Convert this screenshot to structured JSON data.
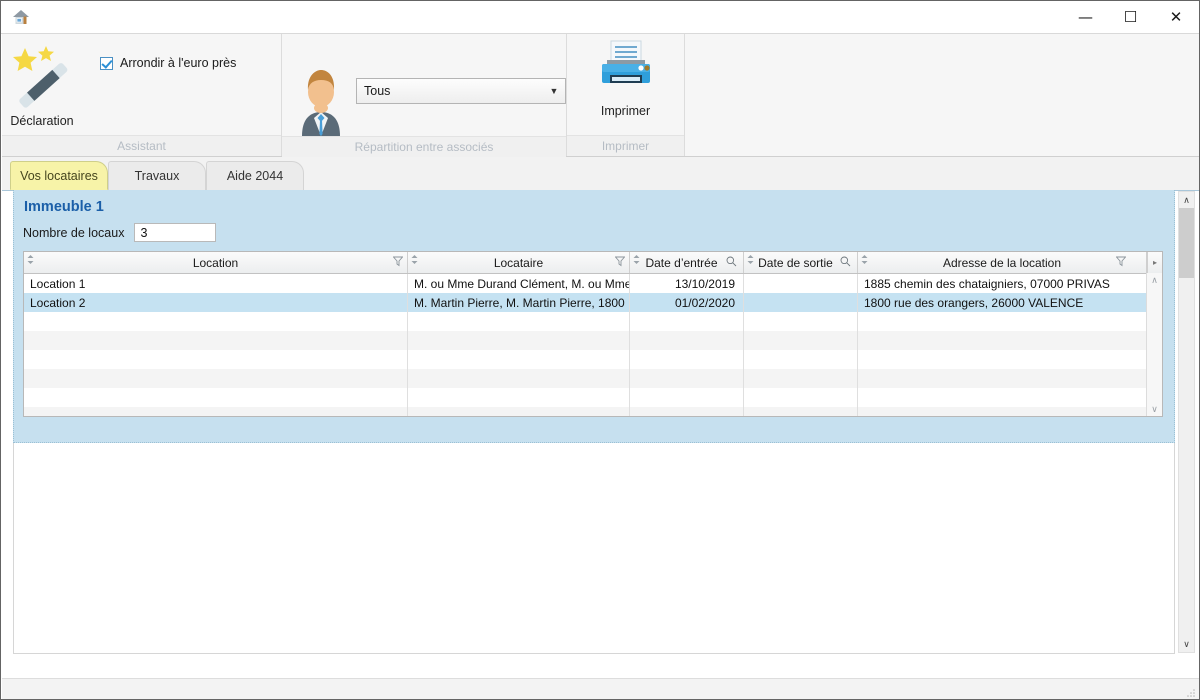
{
  "window": {
    "home_icon": "home-icon",
    "minimize": "—",
    "maximize": "☐",
    "close": "✕"
  },
  "ribbon": {
    "groups": [
      {
        "title": "Assistant"
      },
      {
        "title": "Répartition entre associés"
      },
      {
        "title": "Imprimer"
      }
    ],
    "declaration_button": {
      "label": "Déclaration",
      "icon": "magic-wand-icon"
    },
    "round_euro_checkbox": {
      "label": "Arrondir à l'euro près",
      "checked": true
    },
    "partners_icon": "user-avatar-icon",
    "partners_combo": {
      "value": "Tous",
      "arrow": "▼",
      "options": [
        "Tous"
      ]
    },
    "print_button": {
      "label": "Imprimer",
      "icon": "printer-icon"
    }
  },
  "tabs": [
    {
      "label": "Vos locataires",
      "active": true
    },
    {
      "label": "Travaux",
      "active": false
    },
    {
      "label": "Aide 2044",
      "active": false
    }
  ],
  "panel": {
    "building_title": "Immeuble 1",
    "locals_count_label": "Nombre de locaux",
    "locals_count_value": "3"
  },
  "grid": {
    "columns": [
      {
        "label": "Location",
        "icon": "filter-icon",
        "align": "left"
      },
      {
        "label": "Locataire",
        "icon": "filter-icon",
        "align": "left"
      },
      {
        "label": "Date d’entrée",
        "icon": "search-icon",
        "align": "right"
      },
      {
        "label": "Date de sortie",
        "icon": "search-icon",
        "align": "right"
      },
      {
        "label": "Adresse de la location",
        "icon": "filter-icon",
        "align": "left"
      }
    ],
    "rows": [
      {
        "location": "Location 1",
        "locataire": "M. ou Mme Durand Clément, M. ou Mme",
        "date_entree": "13/10/2019",
        "date_sortie": "",
        "adresse": "1885 chemin des chataigniers, 07000 PRIVAS",
        "selected": false
      },
      {
        "location": "Location 2",
        "locataire": "M. Martin Pierre, M. Martin Pierre, 1800",
        "date_entree": "01/02/2020",
        "date_sortie": "",
        "adresse": "1800 rue des orangers, 26000 VALENCE",
        "selected": true
      },
      {
        "location": "",
        "locataire": "",
        "date_entree": "",
        "date_sortie": "",
        "adresse": "",
        "selected": false
      },
      {
        "location": "",
        "locataire": "",
        "date_entree": "",
        "date_sortie": "",
        "adresse": "",
        "selected": false
      },
      {
        "location": "",
        "locataire": "",
        "date_entree": "",
        "date_sortie": "",
        "adresse": "",
        "selected": false
      },
      {
        "location": "",
        "locataire": "",
        "date_entree": "",
        "date_sortie": "",
        "adresse": "",
        "selected": false
      },
      {
        "location": "",
        "locataire": "",
        "date_entree": "",
        "date_sortie": "",
        "adresse": "",
        "selected": false
      },
      {
        "location": "",
        "locataire": "",
        "date_entree": "",
        "date_sortie": "",
        "adresse": "",
        "selected": false
      }
    ],
    "scroll_up": "∧",
    "scroll_down": "∨",
    "column_chooser": "▸"
  },
  "outer_scrollbar": {
    "up": "∧",
    "down": "∨"
  },
  "colors": {
    "tab_active": "#f7f3a8",
    "panel_blue": "#c6e0ef",
    "row_selected": "#c5e2f2",
    "title_accent": "#1b5fa8",
    "group_title": "#b5bcc4"
  }
}
